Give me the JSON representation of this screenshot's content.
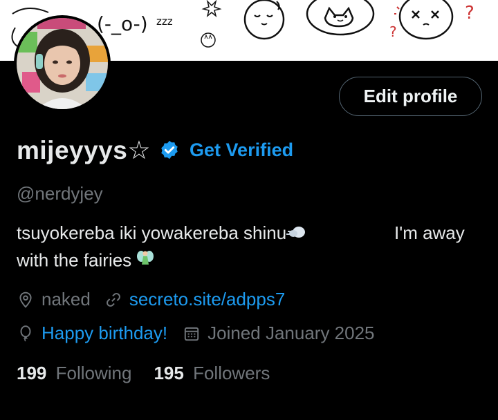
{
  "banner": {
    "sleepy_face": "(-_o-)",
    "zzz": "zzz",
    "question_marks": [
      "?",
      "?"
    ]
  },
  "profile": {
    "edit_button": "Edit profile",
    "display_name": "mijeyyys☆",
    "get_verified": "Get Verified",
    "handle": "@nerdyjey",
    "bio_part1": "tsuyokereba iki yowakereba shinu",
    "bio_part2": "I'm away",
    "bio_part3": "with the fairies",
    "location": "naked",
    "website": "secreto.site/adpps7",
    "birthday": "Happy birthday!",
    "joined": "Joined January 2025"
  },
  "stats": {
    "following_count": "199",
    "following_label": "Following",
    "followers_count": "195",
    "followers_label": "Followers"
  },
  "colors": {
    "accent": "#1d9bf0",
    "muted": "#71767b",
    "text": "#e7e9ea",
    "background": "#000000"
  }
}
